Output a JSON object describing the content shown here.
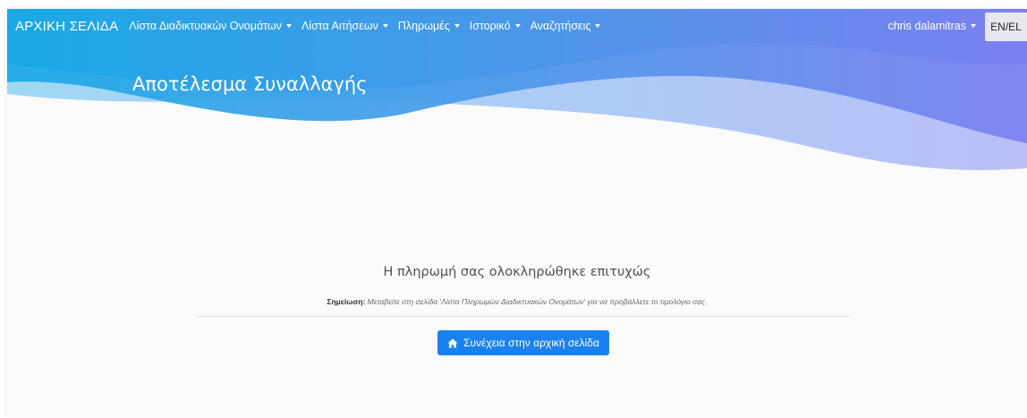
{
  "navbar": {
    "brand": "ΑΡΧΙΚΗ ΣΕΛΙΔΑ",
    "items": [
      {
        "label": "Λίστα Διαδικτυακών Ονομάτων"
      },
      {
        "label": "Λίστα Αιτήσεων"
      },
      {
        "label": "Πληρωμές"
      },
      {
        "label": "Ιστορικό"
      },
      {
        "label": "Αναζητήσεις"
      }
    ],
    "user": "chris dalamitras",
    "language": "EN/EL"
  },
  "page": {
    "title": "Αποτέλεσμα Συναλλαγής"
  },
  "result": {
    "message": "Η πληρωμή σας ολοκληρώθηκε επιτυχώς",
    "note_label": "Σημείωση:",
    "note_text": "Μεταβείτε στη σελίδα 'Λίστα Πληρωμών Διαδικτυακών Ονομάτων' για να προβάλλετε το τιμολόγιο σας.",
    "continue_button": "Συνέχεια στην αρχική σελίδα"
  },
  "icons": {
    "home": "home-icon",
    "dropdown": "caret-down-icon"
  },
  "colors": {
    "navbar_start": "#1aa8e4",
    "navbar_end": "#7b7fef",
    "primary_button": "#1a82f0"
  }
}
